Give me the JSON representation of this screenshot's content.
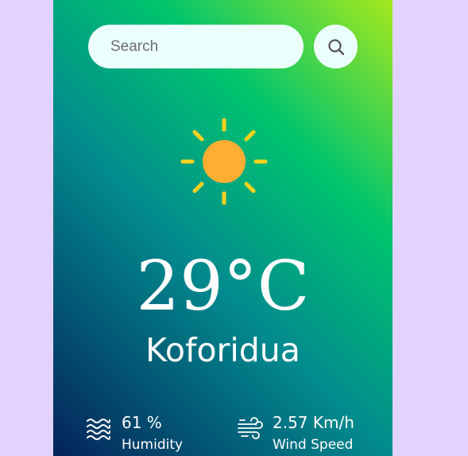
{
  "search": {
    "placeholder": "Search",
    "value": ""
  },
  "icons": {
    "search": "search-icon",
    "weather": "sun-icon",
    "humidity": "humidity-icon",
    "wind": "wind-icon"
  },
  "weather": {
    "temperature": "29°C",
    "city": "Koforidua"
  },
  "details": {
    "humidity": {
      "value": "61 %",
      "label": "Humidity"
    },
    "wind": {
      "value": "2.57 Km/h",
      "label": "Wind Speed"
    }
  },
  "colors": {
    "page_bg": "#e2d3fe",
    "gradient_top": "#a6e81c",
    "gradient_mid": "#00c46e",
    "gradient_bottom": "#04235a",
    "sun": "#ffad33",
    "sun_rays": "#ffd21f",
    "search_bg": "#ebfffc"
  }
}
